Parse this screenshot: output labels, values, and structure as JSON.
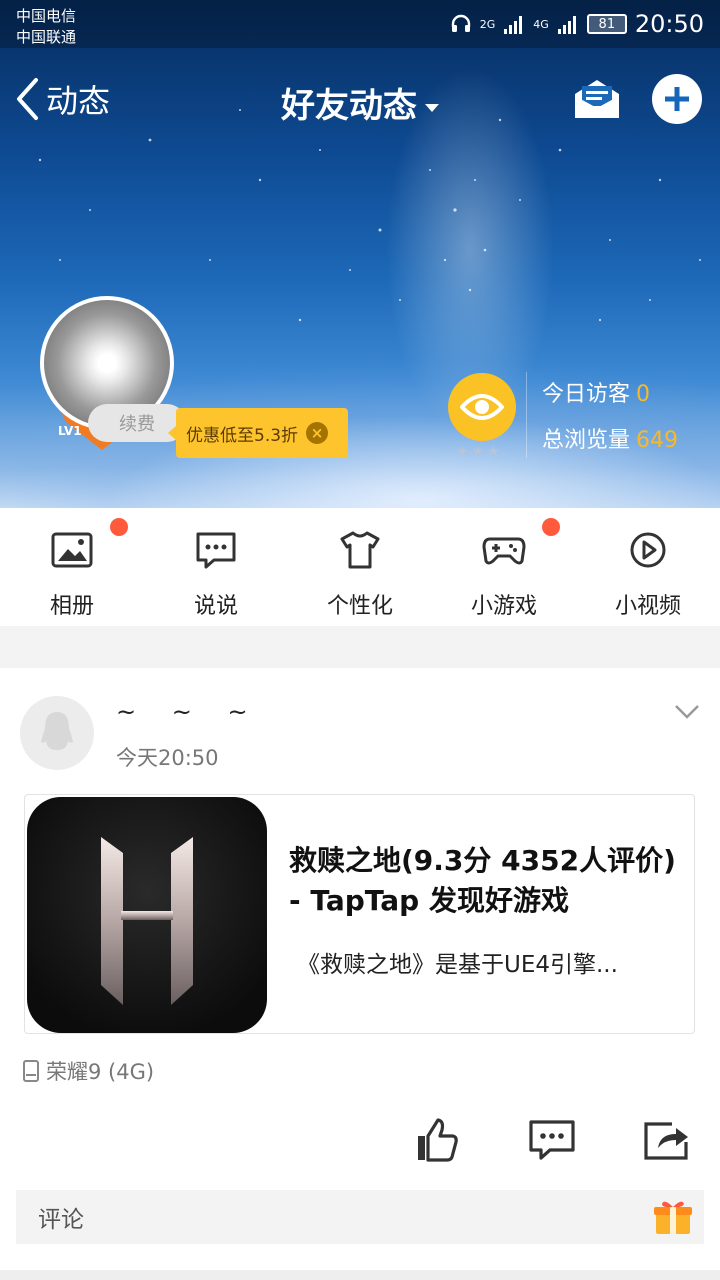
{
  "status_bar": {
    "carrier_1": "中国电信",
    "carrier_2": "中国联通",
    "signal_1": "2G",
    "signal_2": "4G",
    "battery": "81",
    "time": "20:50"
  },
  "nav": {
    "back_label": "动态",
    "title": "好友动态",
    "icons": [
      "mail-icon",
      "plus-icon"
    ]
  },
  "profile": {
    "level": "LV1",
    "renew_label": "续费",
    "promo_text": "优惠低至5.3折",
    "visitors_today_label": "今日访客",
    "visitors_today": "0",
    "total_views_label": "总浏览量",
    "total_views": "649"
  },
  "quick_actions": [
    {
      "label": "相册",
      "icon": "photo-album-icon",
      "badge": true
    },
    {
      "label": "说说",
      "icon": "chat-bubble-icon",
      "badge": false
    },
    {
      "label": "个性化",
      "icon": "tshirt-icon",
      "badge": false
    },
    {
      "label": "小游戏",
      "icon": "gamepad-icon",
      "badge": true
    },
    {
      "label": "小视频",
      "icon": "video-play-icon",
      "badge": false
    }
  ],
  "post": {
    "user_name": "~ ~ ~",
    "time": "今天20:50",
    "link_title": "救赎之地(9.3分 4352人评价) - TapTap 发现好游戏",
    "link_desc": "《救赎之地》是基于UE4引擎...",
    "device": "荣耀9 (4G)",
    "comment_placeholder": "评论"
  },
  "colors": {
    "accent_yellow": "#fbc226",
    "badge_red": "#ff5a3c",
    "hero_blue": "#1d69b8"
  }
}
